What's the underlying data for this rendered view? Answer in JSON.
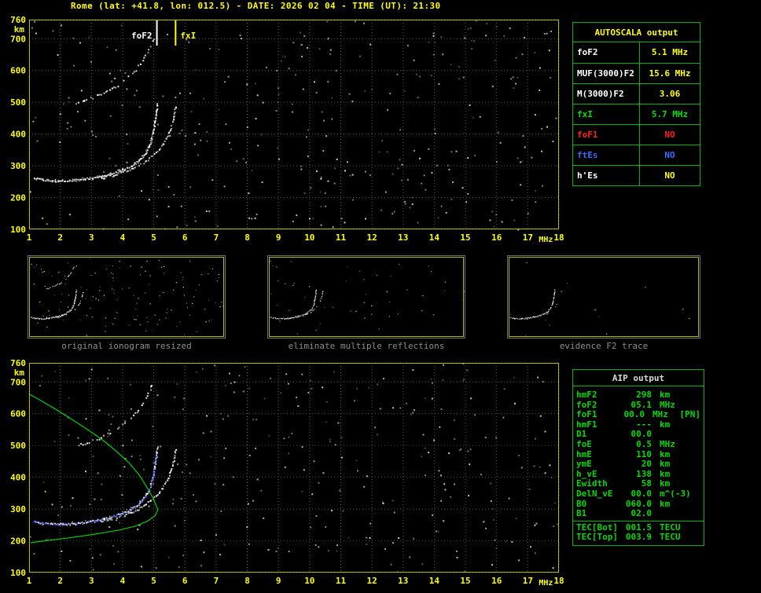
{
  "header": {
    "title": "Rome (lat: +41.8, lon: 012.5) - DATE: 2026 02 04 - TIME (UT): 21:30"
  },
  "colors": {
    "background": "#000000",
    "axis_text": "#ffff00",
    "plot_frame": "#b8b800",
    "grid": "#4f4f4f",
    "echo": "#ffffff",
    "table_border": "#00b400",
    "aip_text": "#00d800",
    "profile_green": "#00cc00",
    "restored_blue": "#2b3cff",
    "caption_gray": "#8c8c8c"
  },
  "autoscala_table": {
    "header": "AUTOSCALA output",
    "rows": [
      {
        "label": "foF2",
        "value": "5.1 MHz",
        "label_color": "#ffffff",
        "value_color": "#ffff00"
      },
      {
        "label": "MUF(3000)F2",
        "value": "15.6 MHz",
        "label_color": "#ffffff",
        "value_color": "#ffff00"
      },
      {
        "label": "M(3000)F2",
        "value": "3.06",
        "label_color": "#ffffff",
        "value_color": "#ffff00"
      },
      {
        "label": "fxI",
        "value": "5.7 MHz",
        "label_color": "#00e000",
        "value_color": "#00e000"
      },
      {
        "label": "foF1",
        "value": "NO",
        "label_color": "#ff2020",
        "value_color": "#ff2020"
      },
      {
        "label": "ftEs",
        "value": "NO",
        "label_color": "#3a6bff",
        "value_color": "#3a6bff"
      },
      {
        "label": "h'Es",
        "value": "NO",
        "label_color": "#ffffff",
        "value_color": "#ffff00"
      }
    ]
  },
  "thumbnails": [
    {
      "caption": "original ionogram resized",
      "content": "full"
    },
    {
      "caption": "eliminate multiple reflections",
      "content": "clean"
    },
    {
      "caption": "evidence F2 trace",
      "content": "f2"
    }
  ],
  "aip_table": {
    "header": "AIP output",
    "rows": [
      {
        "label": "hmF2",
        "value": "298",
        "unit": "km"
      },
      {
        "label": "foF2",
        "value": "05.1",
        "unit": "MHz"
      },
      {
        "label": "foF1",
        "value": "00.0",
        "unit": "MHz",
        "note": "[PN]"
      },
      {
        "label": "hmF1",
        "value": "---",
        "unit": "km"
      },
      {
        "label": "D1",
        "value": "00.0",
        "unit": ""
      },
      {
        "label": "foE",
        "value": "0.5",
        "unit": "MHz"
      },
      {
        "label": "hmE",
        "value": "110",
        "unit": "km"
      },
      {
        "label": "ymE",
        "value": "20",
        "unit": "km"
      },
      {
        "label": "h_vE",
        "value": "138",
        "unit": "km"
      },
      {
        "label": "Ewidth",
        "value": "58",
        "unit": "km"
      },
      {
        "label": "DelN_vE",
        "value": "00.0",
        "unit": "m^(-3)"
      },
      {
        "label": "B0",
        "value": "060.0",
        "unit": "km"
      },
      {
        "label": "B1",
        "value": "02.0",
        "unit": ""
      }
    ],
    "tec_rows": [
      {
        "label": "TEC[Bot]",
        "value": "001.5",
        "unit": "TECU"
      },
      {
        "label": "TEC[Top]",
        "value": "003.9",
        "unit": "TECU"
      }
    ]
  },
  "chart_data": [
    {
      "type": "scatter",
      "name": "recorded ionogram",
      "xlabel": "MHz",
      "ylabel": "km",
      "x_range": [
        1,
        18
      ],
      "y_range": [
        100,
        760
      ],
      "x_ticks": [
        1,
        2,
        3,
        4,
        5,
        6,
        7,
        8,
        9,
        10,
        11,
        12,
        13,
        14,
        15,
        16,
        17,
        18
      ],
      "y_ticks": [
        100,
        200,
        300,
        400,
        500,
        600,
        700,
        760
      ],
      "grid": true,
      "series": [
        {
          "name": "F2-trace-o-mode",
          "color": "#ffffff",
          "points": [
            [
              1.15,
              262
            ],
            [
              1.5,
              257
            ],
            [
              1.9,
              254
            ],
            [
              2.3,
              255
            ],
            [
              2.7,
              259
            ],
            [
              3.1,
              265
            ],
            [
              3.5,
              273
            ],
            [
              3.9,
              285
            ],
            [
              4.2,
              298
            ],
            [
              4.5,
              316
            ],
            [
              4.72,
              340
            ],
            [
              4.87,
              370
            ],
            [
              4.96,
              405
            ],
            [
              5.03,
              445
            ],
            [
              5.08,
              478
            ],
            [
              5.1,
              500
            ]
          ]
        },
        {
          "name": "F2-trace-x-mode",
          "color": "#ffffff",
          "points": [
            [
              3.3,
              263
            ],
            [
              3.7,
              272
            ],
            [
              4.1,
              284
            ],
            [
              4.5,
              302
            ],
            [
              4.85,
              325
            ],
            [
              5.15,
              352
            ],
            [
              5.38,
              385
            ],
            [
              5.53,
              420
            ],
            [
              5.63,
              455
            ],
            [
              5.69,
              495
            ]
          ]
        },
        {
          "name": "second-hop-reflection",
          "color": "#ffffff",
          "points": [
            [
              2.5,
              500
            ],
            [
              2.9,
              512
            ],
            [
              3.3,
              527
            ],
            [
              3.7,
              547
            ],
            [
              4.0,
              567
            ],
            [
              4.3,
              592
            ],
            [
              4.55,
              622
            ],
            [
              4.75,
              655
            ],
            [
              4.9,
              685
            ],
            [
              5.0,
              710
            ]
          ]
        }
      ],
      "markers": [
        {
          "label": "foF2",
          "freq_mhz": 5.1,
          "color": "#ffffff",
          "label_side": "left"
        },
        {
          "label": "fxI",
          "freq_mhz": 5.7,
          "color": "#ffff00",
          "label_side": "right"
        }
      ]
    },
    {
      "type": "scatter",
      "name": "restored ionogram with electron density profile",
      "xlabel": "MHz",
      "ylabel": "km",
      "x_range": [
        1,
        18
      ],
      "y_range": [
        100,
        760
      ],
      "x_ticks": [
        1,
        2,
        3,
        4,
        5,
        6,
        7,
        8,
        9,
        10,
        11,
        12,
        13,
        14,
        15,
        16,
        17,
        18
      ],
      "y_ticks": [
        100,
        200,
        300,
        400,
        500,
        600,
        700,
        760
      ],
      "grid": true,
      "series": [
        {
          "name": "F2-trace-o-mode",
          "color": "#ffffff",
          "points": [
            [
              1.15,
              262
            ],
            [
              1.5,
              257
            ],
            [
              1.9,
              254
            ],
            [
              2.3,
              255
            ],
            [
              2.7,
              259
            ],
            [
              3.1,
              265
            ],
            [
              3.5,
              273
            ],
            [
              3.9,
              285
            ],
            [
              4.2,
              298
            ],
            [
              4.5,
              316
            ],
            [
              4.72,
              340
            ],
            [
              4.87,
              370
            ],
            [
              4.96,
              405
            ],
            [
              5.03,
              445
            ],
            [
              5.08,
              478
            ],
            [
              5.1,
              500
            ]
          ]
        },
        {
          "name": "F2-trace-x-mode",
          "color": "#ffffff",
          "points": [
            [
              3.3,
              263
            ],
            [
              3.7,
              272
            ],
            [
              4.1,
              284
            ],
            [
              4.5,
              302
            ],
            [
              4.85,
              325
            ],
            [
              5.15,
              352
            ],
            [
              5.38,
              385
            ],
            [
              5.53,
              420
            ],
            [
              5.63,
              455
            ],
            [
              5.69,
              495
            ]
          ]
        },
        {
          "name": "second-hop-reflection",
          "color": "#ffffff",
          "points": [
            [
              2.5,
              500
            ],
            [
              2.9,
              512
            ],
            [
              3.3,
              527
            ],
            [
              3.7,
              547
            ],
            [
              4.0,
              567
            ],
            [
              4.3,
              592
            ],
            [
              4.55,
              622
            ],
            [
              4.75,
              655
            ],
            [
              4.9,
              685
            ],
            [
              5.0,
              710
            ]
          ]
        }
      ],
      "profile": {
        "name": "electron-density-profile",
        "color": "#00cc00",
        "peak": {
          "freq_mhz": 5.1,
          "height_km": 298
        },
        "points": [
          [
            1.0,
            662
          ],
          [
            1.4,
            640
          ],
          [
            1.8,
            617
          ],
          [
            2.2,
            593
          ],
          [
            2.6,
            568
          ],
          [
            3.0,
            542
          ],
          [
            3.4,
            514
          ],
          [
            3.8,
            482
          ],
          [
            4.2,
            446
          ],
          [
            4.55,
            405
          ],
          [
            4.82,
            362
          ],
          [
            5.0,
            330
          ],
          [
            5.13,
            298
          ],
          [
            5.05,
            280
          ],
          [
            4.8,
            262
          ],
          [
            4.4,
            246
          ],
          [
            3.9,
            234
          ],
          [
            3.3,
            224
          ],
          [
            2.7,
            215
          ],
          [
            2.1,
            207
          ],
          [
            1.5,
            200
          ],
          [
            1.05,
            194
          ]
        ]
      },
      "restored_trace": {
        "name": "autoscala-restored-trace",
        "color": "#2b3cff",
        "points": [
          [
            1.15,
            262
          ],
          [
            1.5,
            257
          ],
          [
            1.9,
            254
          ],
          [
            2.3,
            255
          ],
          [
            2.7,
            259
          ],
          [
            3.1,
            265
          ],
          [
            3.5,
            273
          ],
          [
            3.9,
            285
          ],
          [
            4.2,
            298
          ],
          [
            4.5,
            316
          ],
          [
            4.72,
            340
          ],
          [
            4.87,
            370
          ],
          [
            4.96,
            405
          ],
          [
            5.03,
            445
          ],
          [
            5.08,
            478
          ]
        ]
      }
    }
  ]
}
